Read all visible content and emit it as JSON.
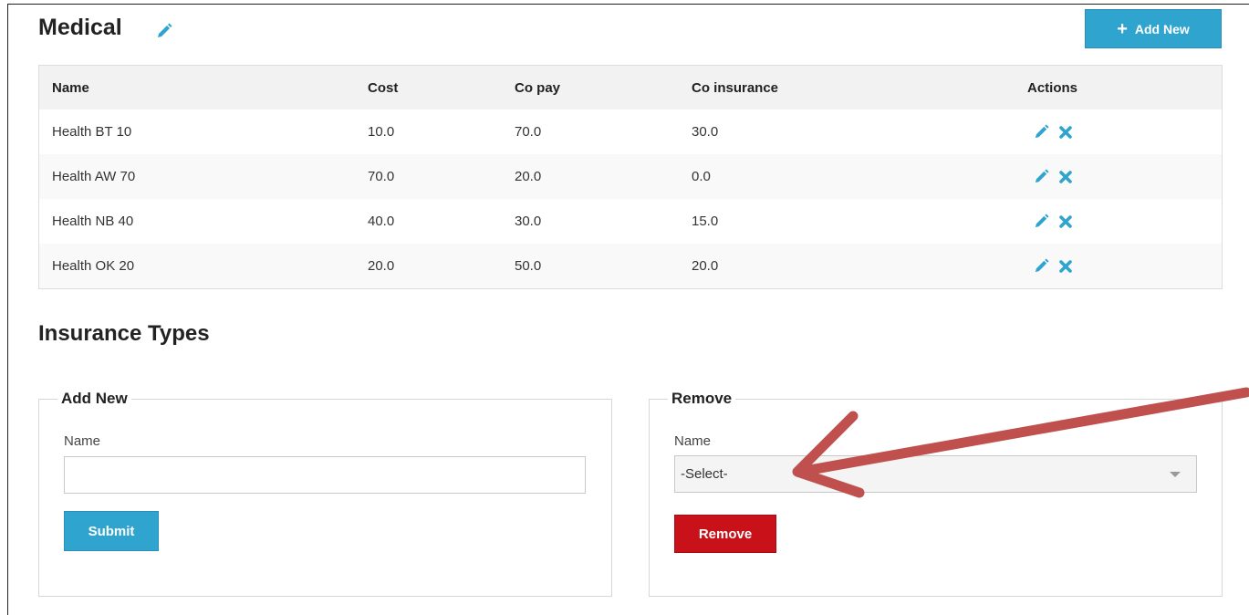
{
  "medical": {
    "title": "Medical",
    "add_new_label": "Add New"
  },
  "table": {
    "headers": {
      "name": "Name",
      "cost": "Cost",
      "copay": "Co pay",
      "coinsurance": "Co insurance",
      "actions": "Actions"
    },
    "rows": [
      {
        "name": "Health BT 10",
        "cost": "10.0",
        "copay": "70.0",
        "coinsurance": "30.0"
      },
      {
        "name": "Health AW 70",
        "cost": "70.0",
        "copay": "20.0",
        "coinsurance": "0.0"
      },
      {
        "name": "Health NB 40",
        "cost": "40.0",
        "copay": "30.0",
        "coinsurance": "15.0"
      },
      {
        "name": "Health OK 20",
        "cost": "20.0",
        "copay": "50.0",
        "coinsurance": "20.0"
      }
    ]
  },
  "insurance_types": {
    "title": "Insurance Types",
    "add_new": {
      "legend": "Add New",
      "name_label": "Name",
      "name_value": "",
      "submit_label": "Submit"
    },
    "remove": {
      "legend": "Remove",
      "name_label": "Name",
      "selected_option": "-Select-",
      "remove_label": "Remove"
    }
  },
  "icons": {
    "edit": "pencil-icon",
    "delete": "x-icon",
    "add": "plus-icon",
    "dropdown": "caret-down-icon"
  },
  "colors": {
    "primary": "#2fa4cf",
    "danger": "#c9111a",
    "annotation_arrow": "#c0504d"
  }
}
